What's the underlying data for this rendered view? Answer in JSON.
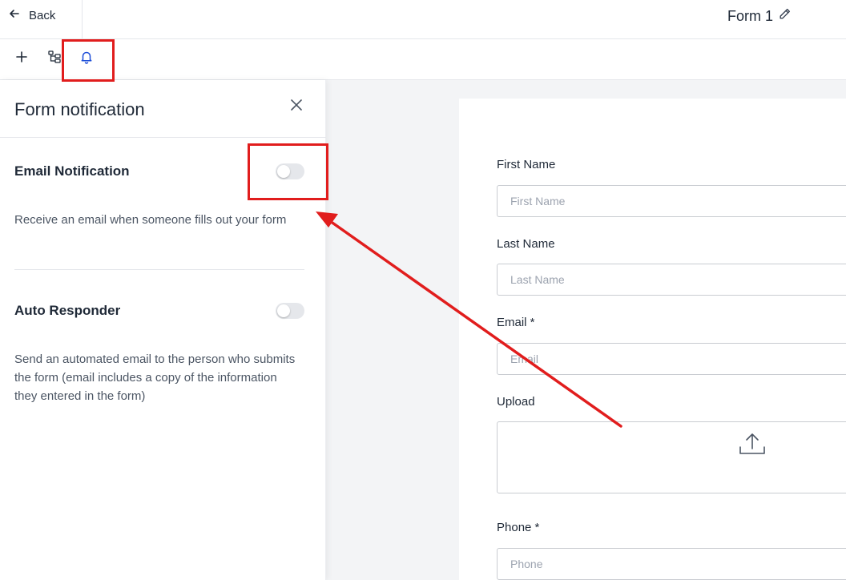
{
  "header": {
    "back_label": "Back",
    "form_title": "Form 1"
  },
  "toolbar": {
    "items": [
      {
        "icon": "plus-icon"
      },
      {
        "icon": "structure-icon"
      },
      {
        "icon": "bell-icon",
        "active": true
      }
    ]
  },
  "panel": {
    "title": "Form notification",
    "sections": [
      {
        "title": "Email Notification",
        "description": "Receive an email when someone fills out your form",
        "enabled": false
      },
      {
        "title": "Auto Responder",
        "description": "Send an automated email to the person who submits the form (email includes a copy of the information they entered in the form)",
        "enabled": false
      }
    ]
  },
  "form": {
    "fields": [
      {
        "label": "First Name",
        "placeholder": "First Name"
      },
      {
        "label": "Last Name",
        "placeholder": "Last Name"
      },
      {
        "label": "Email *",
        "placeholder": "Email"
      },
      {
        "label": "Upload"
      },
      {
        "label": "Phone *",
        "placeholder": "Phone"
      }
    ]
  },
  "colors": {
    "accent": "#1d4ed8",
    "annotation": "#e11d1d",
    "canvas_bg": "#f3f4f6"
  }
}
